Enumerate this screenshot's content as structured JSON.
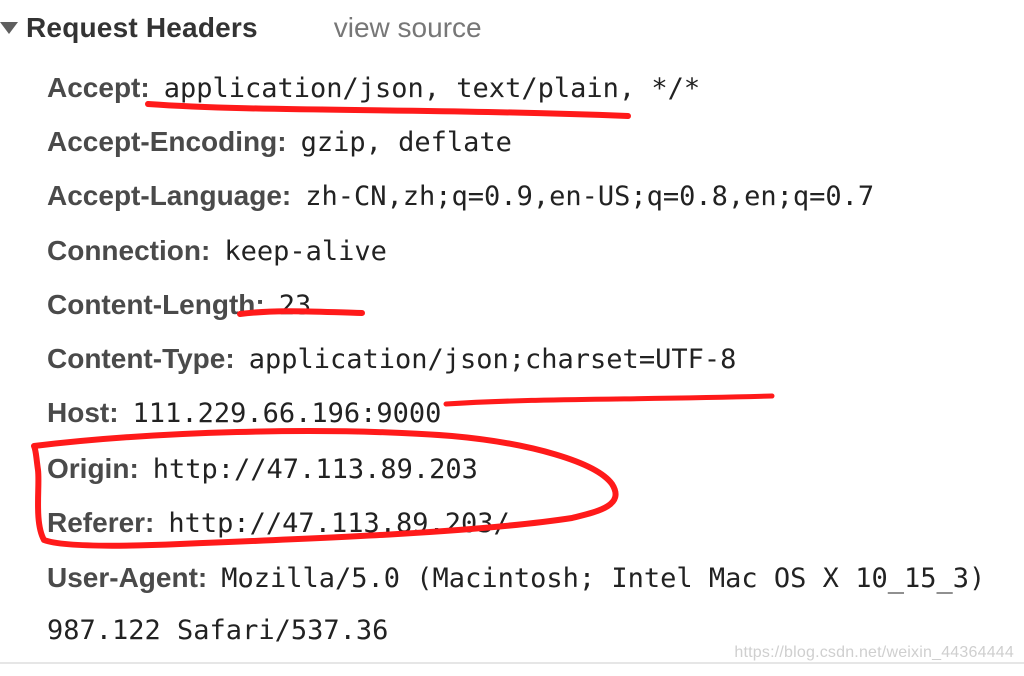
{
  "section": {
    "title": "Request Headers",
    "view_source": "view source"
  },
  "headers": [
    {
      "name": "Accept:",
      "value": "application/json, text/plain, */*"
    },
    {
      "name": "Accept-Encoding:",
      "value": "gzip, deflate"
    },
    {
      "name": "Accept-Language:",
      "value": "zh-CN,zh;q=0.9,en-US;q=0.8,en;q=0.7"
    },
    {
      "name": "Connection:",
      "value": "keep-alive"
    },
    {
      "name": "Content-Length:",
      "value": "23"
    },
    {
      "name": "Content-Type:",
      "value": "application/json;charset=UTF-8"
    },
    {
      "name": "Host:",
      "value": "111.229.66.196:9000"
    },
    {
      "name": "Origin:",
      "value": "http://47.113.89.203"
    },
    {
      "name": "Referer:",
      "value": "http://47.113.89.203/"
    },
    {
      "name": "User-Agent:",
      "value": "Mozilla/5.0 (Macintosh; Intel Mac OS X 10_15_3)"
    }
  ],
  "user_agent_continuation": "987.122 Safari/537.36",
  "watermark": "https://blog.csdn.net/weixin_44364444",
  "colors": {
    "annotation": "#ff1a1a",
    "header_name": "#4a4a4a",
    "header_value": "#222222",
    "muted": "#777777"
  },
  "icons": {
    "toggle": "triangle-down-icon"
  }
}
